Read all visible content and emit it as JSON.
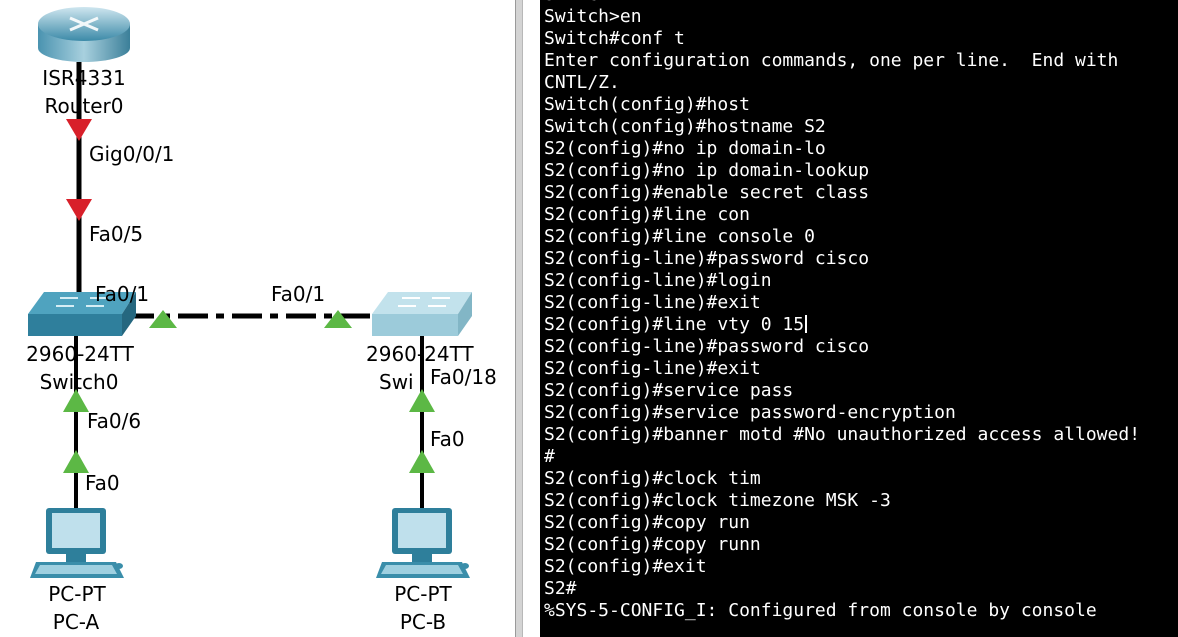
{
  "topology": {
    "router": {
      "model": "ISR4331",
      "name": "Router0"
    },
    "switch0": {
      "model": "2960-24TT",
      "name": "Switch0"
    },
    "switch1": {
      "model": "2960-24TT",
      "name": "Swi"
    },
    "pc_a": {
      "model": "PC-PT",
      "name": "PC-A"
    },
    "pc_b": {
      "model": "PC-PT",
      "name": "PC-B"
    },
    "ports": {
      "router_gig": "Gig0/0/1",
      "sw0_fa05": "Fa0/5",
      "sw0_fa01": "Fa0/1",
      "sw1_fa01": "Fa0/1",
      "sw0_fa06": "Fa0/6",
      "pca_fa0": "Fa0",
      "sw1_fa018": "Fa0/18",
      "pcb_fa0": "Fa0"
    },
    "colors": {
      "link_down": "#d8202a",
      "link_up": "#5cb845",
      "switch0": "#3a8aa6",
      "switch1": "#a9d3df"
    }
  },
  "terminal": {
    "lines": [
      "Switch>",
      "Switch>en",
      "Switch#conf t",
      "Enter configuration commands, one per line.  End with",
      "CNTL/Z.",
      "Switch(config)#host",
      "Switch(config)#hostname S2",
      "S2(config)#no ip domain-lo",
      "S2(config)#no ip domain-lookup",
      "S2(config)#enable secret class",
      "S2(config)#line con",
      "S2(config)#line console 0",
      "S2(config-line)#password cisco",
      "S2(config-line)#login",
      "S2(config-line)#exit",
      "S2(config)#line vty 0 15",
      "S2(config-line)#password cisco",
      "S2(config-line)#exit",
      "S2(config)#service pass",
      "S2(config)#service password-encryption",
      "S2(config)#banner motd #No unauthorized access allowed!",
      "#",
      "S2(config)#clock tim",
      "S2(config)#clock timezone MSK -3",
      "S2(config)#copy run",
      "S2(config)#copy runn",
      "S2(config)#exit",
      "S2#",
      "%SYS-5-CONFIG_I: Configured from console by console"
    ]
  }
}
